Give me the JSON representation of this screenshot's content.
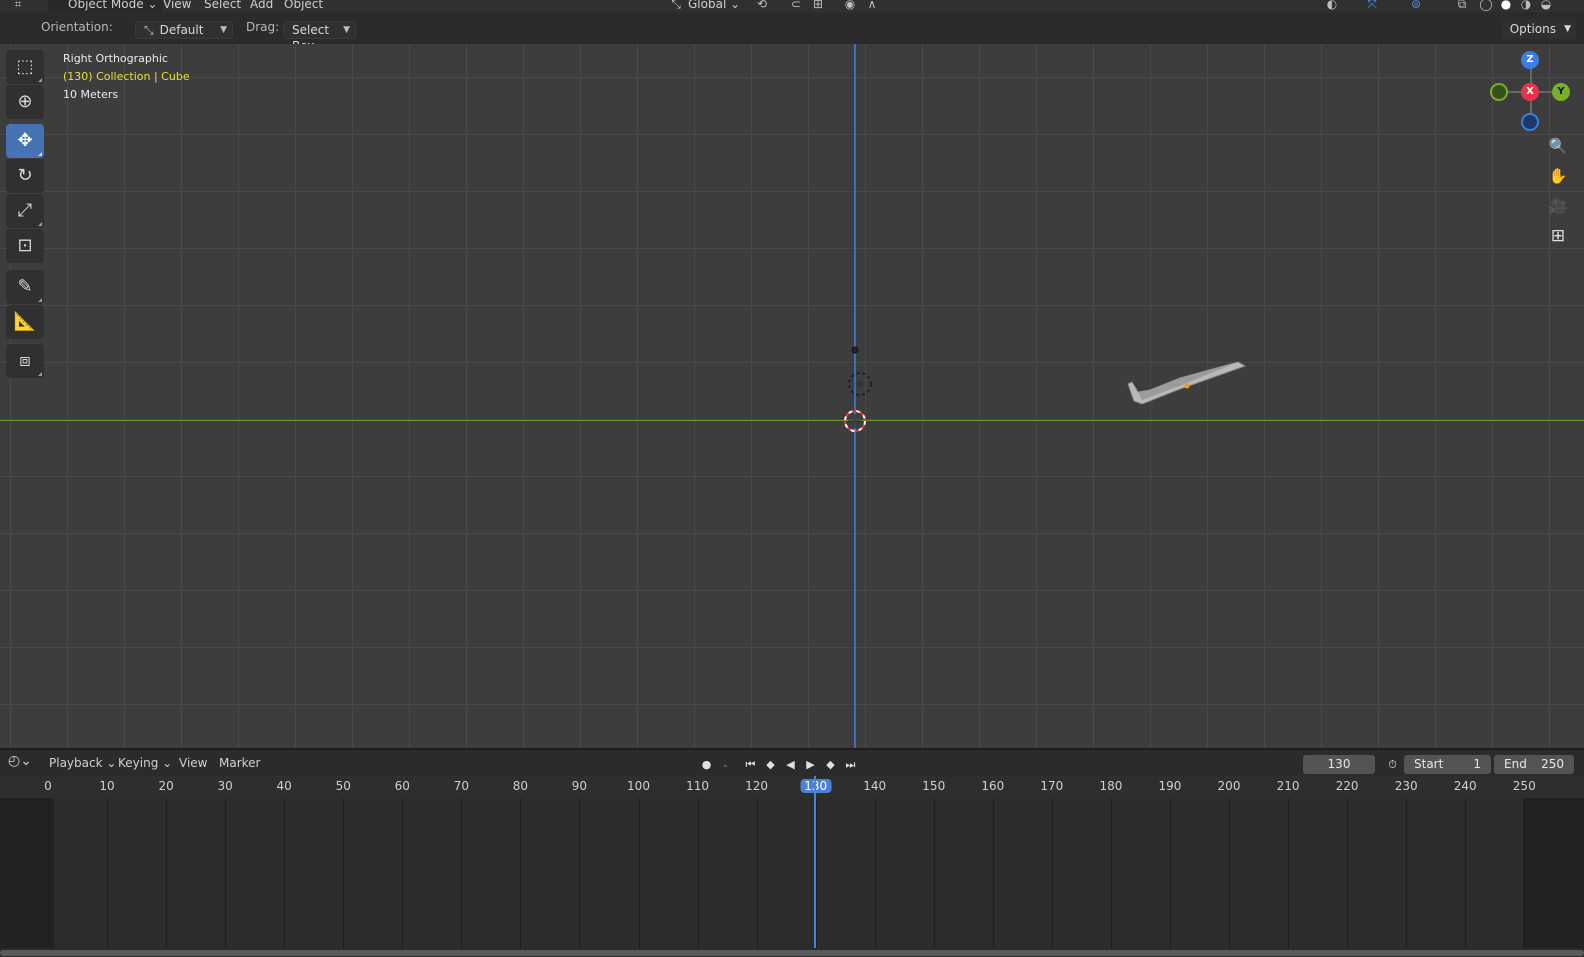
{
  "header": {
    "mode_label": "Object Mode",
    "menus": [
      "View",
      "Select",
      "Add",
      "Object"
    ],
    "transform_orientation": "Global"
  },
  "tool_settings": {
    "orientation_label": "Orientation:",
    "orientation_value": "Default",
    "drag_label": "Drag:",
    "drag_value": "Select Box",
    "options_label": "Options"
  },
  "viewport": {
    "view_name": "Right Orthographic",
    "collection_info": "(130) Collection | Cube",
    "scale_text": "10 Meters",
    "gizmo": {
      "z": "Z",
      "x": "X",
      "y": "Y"
    },
    "colors": {
      "x_axis": "#e8334a",
      "y_axis": "#78b02b",
      "z_axis": "#3b7ee0"
    }
  },
  "timeline": {
    "menus": [
      "Playback",
      "Keying",
      "View",
      "Marker"
    ],
    "current_frame": "130",
    "start_label": "Start",
    "start_value": "1",
    "end_label": "End",
    "end_value": "250",
    "ticks": [
      "0",
      "10",
      "20",
      "30",
      "40",
      "50",
      "60",
      "70",
      "80",
      "90",
      "100",
      "110",
      "120",
      "130",
      "140",
      "150",
      "160",
      "170",
      "180",
      "190",
      "200",
      "210",
      "220",
      "230",
      "240",
      "250"
    ],
    "accent": "#4b82d4"
  }
}
